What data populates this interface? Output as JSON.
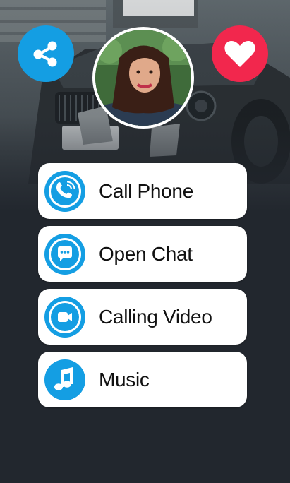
{
  "actions": {
    "share_icon": "share-icon",
    "like_icon": "heart-icon"
  },
  "menu": {
    "items": [
      {
        "label": "Call Phone",
        "icon": "phone-call-icon"
      },
      {
        "label": "Open Chat",
        "icon": "chat-icon"
      },
      {
        "label": "Calling Video",
        "icon": "video-camera-icon"
      },
      {
        "label": "Music",
        "icon": "music-note-icon"
      }
    ]
  },
  "colors": {
    "background": "#22272e",
    "accent_blue": "#149ee3",
    "like_red": "#f2274d",
    "card": "#ffffff"
  }
}
